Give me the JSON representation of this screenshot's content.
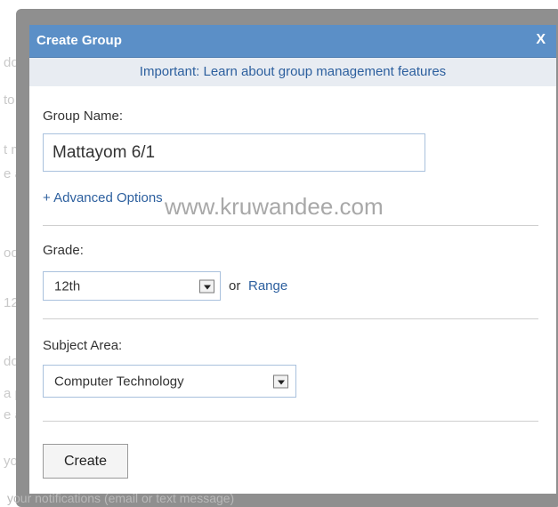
{
  "background": {
    "fragments": [
      "do",
      "to",
      "t m",
      "e a",
      "oo",
      "12",
      "do",
      "a p",
      "e a",
      "yo"
    ],
    "bottom_text": "your notifications (email or text message)"
  },
  "dialog": {
    "title": "Create Group",
    "close_label": "X",
    "notice": "Important: Learn about group management features",
    "group_name_label": "Group Name:",
    "group_name_value": "Mattayom 6/1",
    "advanced_options": "+ Advanced Options",
    "watermark": "www.kruwandee.com",
    "grade_label": "Grade:",
    "grade_value": "12th",
    "or_text": "or",
    "range_link": "Range",
    "subject_label": "Subject Area:",
    "subject_value": "Computer Technology",
    "create_button": "Create"
  },
  "colors": {
    "titlebar": "#5b8fc7",
    "link": "#2c5f9e",
    "notice_bg": "#e8ecf2",
    "overlay": "#8f8f8f"
  }
}
